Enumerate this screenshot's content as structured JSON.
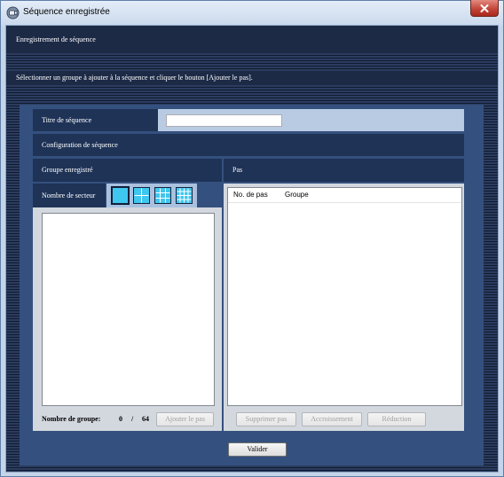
{
  "window": {
    "title": "Séquence enregistrée"
  },
  "icons": {
    "app": "app-icon",
    "close": "close-icon"
  },
  "header": {
    "title": "Enregistrement de séquence"
  },
  "instruction": {
    "text": "Sélectionner un groupe à ajouter à la séquence et cliquer le bouton [Ajouter le pas]."
  },
  "sequence": {
    "title_label": "Titre de séquence",
    "title_value": "",
    "config_label": "Configuration de séquence"
  },
  "groups": {
    "header": "Groupe enregistré",
    "sector_label": "Nombre de secteur",
    "sectors": [
      {
        "icon": "grid-1x1-icon",
        "divisions": 1,
        "selected": true
      },
      {
        "icon": "grid-2x2-icon",
        "divisions": 2,
        "selected": false
      },
      {
        "icon": "grid-3x3-icon",
        "divisions": 3,
        "selected": false
      },
      {
        "icon": "grid-4x4-icon",
        "divisions": 4,
        "selected": false
      }
    ],
    "count_label": "Nombre de groupe:",
    "count": "0",
    "count_separator": "/",
    "count_max": "64",
    "add_button": {
      "label": "Ajouter le pas",
      "enabled": false
    }
  },
  "steps": {
    "header": "Pas",
    "columns": [
      "No. de pas",
      "Groupe"
    ],
    "delete_button": {
      "label": "Supprimer pas",
      "enabled": false
    },
    "increase_button": {
      "label": "Accroissement",
      "enabled": false
    },
    "decrease_button": {
      "label": "Réduction",
      "enabled": false
    }
  },
  "footer": {
    "validate_button": {
      "label": "Valider",
      "enabled": true
    }
  },
  "colors": {
    "window_frame": "#c5d5e9",
    "title_bar_top": "#e4edf8",
    "title_bar_bottom": "#cad9ec",
    "close_button": "#c4463a",
    "band": "#1c2a46",
    "stripe_dark": "#111b31",
    "stripe_light": "#2b3c5f",
    "panel": "#34507e",
    "label_cell": "#1f3357",
    "light_cell": "#b9cbe3",
    "icon_cell": "#a9c1df",
    "frame_gray": "#d3d8df",
    "sector_fill": "#3ec7ef",
    "sector_line": "#ffffff",
    "sector_border": "#15243f",
    "text_light": "#ffffff"
  }
}
